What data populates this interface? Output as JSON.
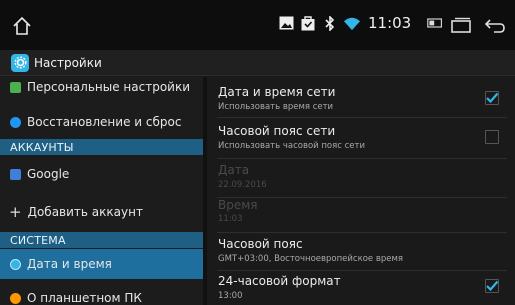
{
  "statusbar": {
    "time": "11:03",
    "icons": [
      "home-icon",
      "image-icon",
      "bag-icon",
      "bluetooth-icon",
      "wifi-icon",
      "battery-icon",
      "window-icon",
      "back-icon"
    ]
  },
  "actionbar": {
    "title": "Настройки"
  },
  "sidebar": {
    "items": [
      {
        "label": "Персональные настройки",
        "color": "#4caf50"
      },
      {
        "label": "Восстановление и сброс",
        "color": "#2196f3"
      }
    ],
    "accounts_header": "АККАУНТЫ",
    "google_label": "Google",
    "add_account_label": "Добавить аккаунт",
    "system_header": "СИСТЕМА",
    "datetime_label": "Дата и время",
    "about_label": "О планшетном ПК"
  },
  "settings": {
    "network_datetime": {
      "title": "Дата и время сети",
      "subtitle": "Использовать время сети",
      "checked": true
    },
    "network_timezone": {
      "title": "Часовой пояс сети",
      "subtitle": "Использовать часовой пояс сети",
      "checked": false
    },
    "date": {
      "title": "Дата",
      "subtitle": "22.09.2016"
    },
    "time": {
      "title": "Время",
      "subtitle": "11:03"
    },
    "timezone": {
      "title": "Часовой пояс",
      "subtitle": "GMT+03:00, Восточноевропейское время"
    },
    "format24": {
      "title": "24-часовой формат",
      "subtitle": "13:00",
      "checked": true
    }
  },
  "colors": {
    "accent": "#33b5e5",
    "header_bg": "#1f5f83",
    "selected_bg": "#1e6f9e"
  }
}
